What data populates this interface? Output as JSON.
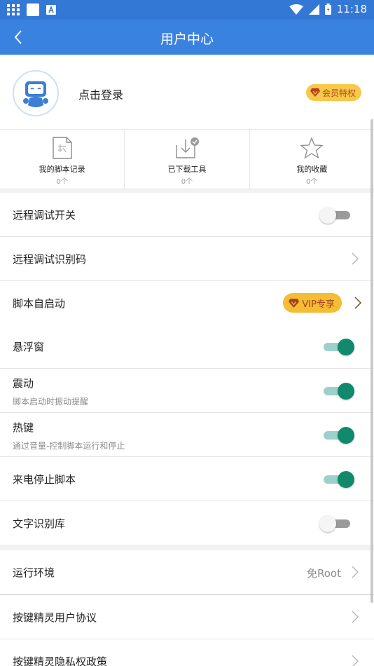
{
  "status_bar": {
    "time": "11:18"
  },
  "app_bar": {
    "title": "用户中心"
  },
  "profile": {
    "login_text": "点击登录",
    "member_badge": "会员特权"
  },
  "stats": [
    {
      "label": "我的脚本记录",
      "count": "0个",
      "icon": "script-doc-icon"
    },
    {
      "label": "已下载工具",
      "count": "0个",
      "icon": "download-icon"
    },
    {
      "label": "我的收藏",
      "count": "0个",
      "icon": "star-icon"
    }
  ],
  "settings": {
    "remote_debug": {
      "label": "远程调试开关",
      "enabled": false
    },
    "remote_code": {
      "label": "远程调试识别码"
    },
    "auto_start": {
      "label": "脚本自启动",
      "badge": "VIP专享"
    },
    "floating_window": {
      "label": "悬浮窗",
      "enabled": true
    },
    "vibration": {
      "label": "震动",
      "sub": "脚本启动时振动提醒",
      "enabled": true
    },
    "hotkey": {
      "label": "热键",
      "sub": "通过音量-控制脚本运行和停止",
      "enabled": true
    },
    "call_stop": {
      "label": "来电停止脚本",
      "enabled": true
    },
    "ocr": {
      "label": "文字识别库",
      "enabled": false
    }
  },
  "about": {
    "runtime": {
      "label": "运行环境",
      "value": "免Root"
    },
    "agreement": {
      "label": "按键精灵用户协议"
    },
    "privacy": {
      "label": "按键精灵隐私权政策"
    }
  },
  "colors": {
    "primary": "#3a82df",
    "toggle_on": "#11896d",
    "vip": "#f5bc35"
  }
}
